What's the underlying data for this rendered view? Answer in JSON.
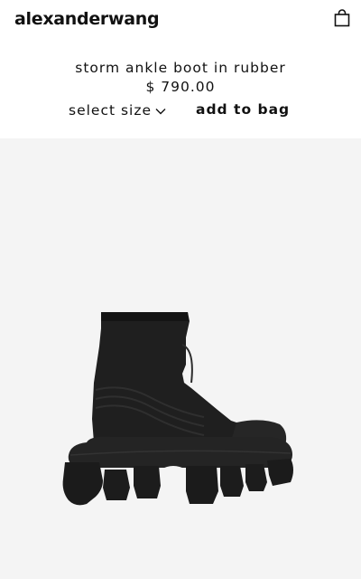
{
  "header": {
    "brand": "alexanderwang",
    "bag_icon": "shopping-bag-icon"
  },
  "product": {
    "name": "storm ankle boot in rubber",
    "price": "$ 790.00"
  },
  "actions": {
    "select_size_label": "select size",
    "select_size_icon": "chevron-down-icon",
    "add_to_bag_label": "add to bag"
  },
  "colors": {
    "background": "#ffffff",
    "image_background": "#f4f4f4",
    "text": "#111111",
    "boot": "#1e1e1e"
  }
}
